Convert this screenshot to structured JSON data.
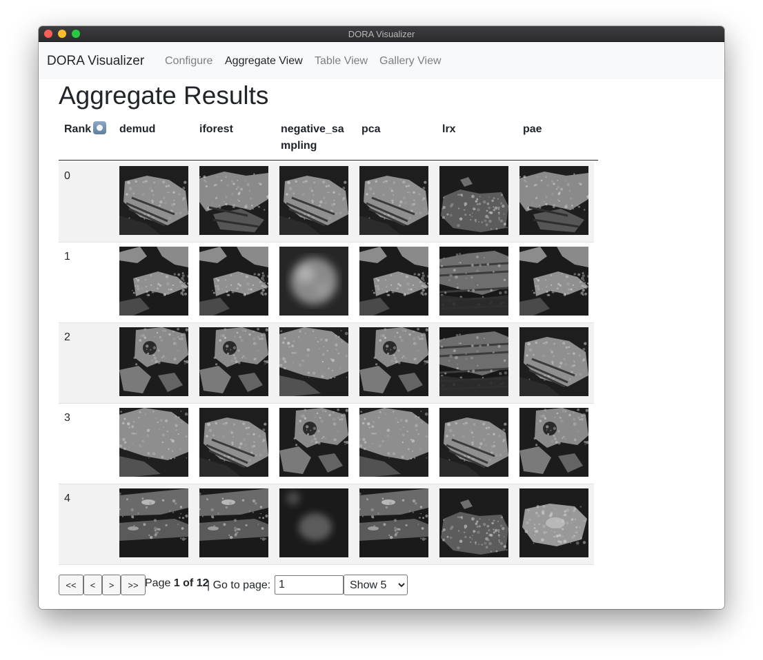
{
  "window": {
    "title": "DORA Visualizer"
  },
  "navbar": {
    "brand": "DORA Visualizer",
    "links": [
      {
        "label": "Configure",
        "active": false
      },
      {
        "label": "Aggregate View",
        "active": true
      },
      {
        "label": "Table View",
        "active": false
      },
      {
        "label": "Gallery View",
        "active": false
      }
    ]
  },
  "page": {
    "title": "Aggregate Results"
  },
  "table": {
    "rank_header": "Rank",
    "rank_sort_icon": "sort-toggle-icon",
    "columns": [
      "demud",
      "iforest",
      "negative_sa\nmpling",
      "pca",
      "lrx",
      "pae"
    ],
    "rows": [
      {
        "rank": "0",
        "thumbnails": [
          "rock-tile-1",
          "rock-tile-2",
          "rock-tile-1",
          "rock-tile-1",
          "rock-tile-3",
          "rock-tile-2"
        ]
      },
      {
        "rank": "1",
        "thumbnails": [
          "rock-tile-4",
          "rock-tile-4",
          "rock-tile-blur",
          "rock-tile-4",
          "rock-tile-5",
          "rock-tile-4"
        ]
      },
      {
        "rank": "2",
        "thumbnails": [
          "rock-tile-6",
          "rock-tile-6",
          "rock-tile-7",
          "rock-tile-6",
          "rock-tile-5",
          "rock-tile-1"
        ]
      },
      {
        "rank": "3",
        "thumbnails": [
          "rock-tile-7",
          "rock-tile-1",
          "rock-tile-6",
          "rock-tile-7",
          "rock-tile-1",
          "rock-tile-6"
        ]
      },
      {
        "rank": "4",
        "thumbnails": [
          "rock-tile-8",
          "rock-tile-8",
          "rock-tile-blur-dark",
          "rock-tile-8",
          "rock-tile-3",
          "rock-tile-9"
        ]
      }
    ]
  },
  "pagination": {
    "first_label": "<<",
    "prev_label": "<",
    "next_label": ">",
    "last_label": ">>",
    "page_prefix": "Page ",
    "page_current": "1 of 12",
    "page_suffix": "| Go to page:",
    "goto_value": "1",
    "show_selected": "Show 5",
    "show_options": [
      "Show 5"
    ]
  }
}
